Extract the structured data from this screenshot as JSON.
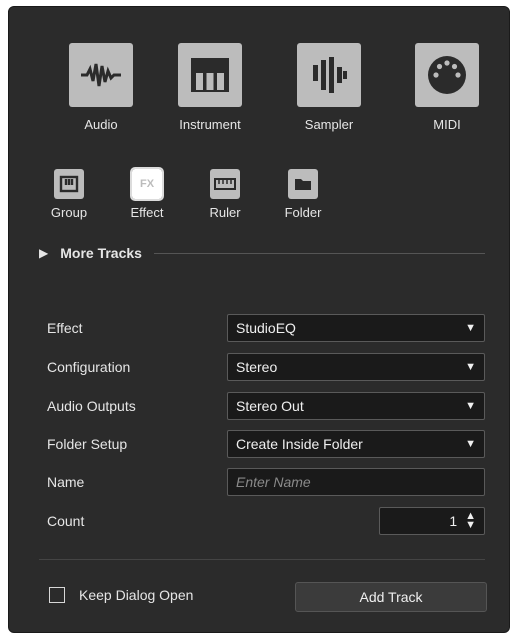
{
  "track_types": [
    {
      "label": "Audio",
      "icon": "waveform-icon"
    },
    {
      "label": "Instrument",
      "icon": "piano-keys-icon"
    },
    {
      "label": "Sampler",
      "icon": "sampler-bars-icon"
    },
    {
      "label": "MIDI",
      "icon": "midi-connector-icon"
    }
  ],
  "small_types": [
    {
      "label": "Group",
      "icon": "group-icon"
    },
    {
      "label": "Effect",
      "icon": "fx-icon",
      "icon_text": "FX"
    },
    {
      "label": "Ruler",
      "icon": "ruler-icon"
    },
    {
      "label": "Folder",
      "icon": "folder-icon"
    }
  ],
  "more_tracks": {
    "label": "More Tracks"
  },
  "fields": {
    "effect": {
      "label": "Effect",
      "value": "StudioEQ"
    },
    "configuration": {
      "label": "Configuration",
      "value": "Stereo"
    },
    "audio_outputs": {
      "label": "Audio Outputs",
      "value": "Stereo Out"
    },
    "folder_setup": {
      "label": "Folder Setup",
      "value": "Create Inside Folder"
    },
    "name": {
      "label": "Name",
      "placeholder": "Enter Name"
    },
    "count": {
      "label": "Count",
      "value": "1"
    }
  },
  "footer": {
    "keep_open_label": "Keep Dialog Open",
    "keep_open_checked": false,
    "add_track_label": "Add Track"
  },
  "colors": {
    "background": "#2b2b2b",
    "tile": "#bcbcbc",
    "field": "#1a1a1a"
  }
}
